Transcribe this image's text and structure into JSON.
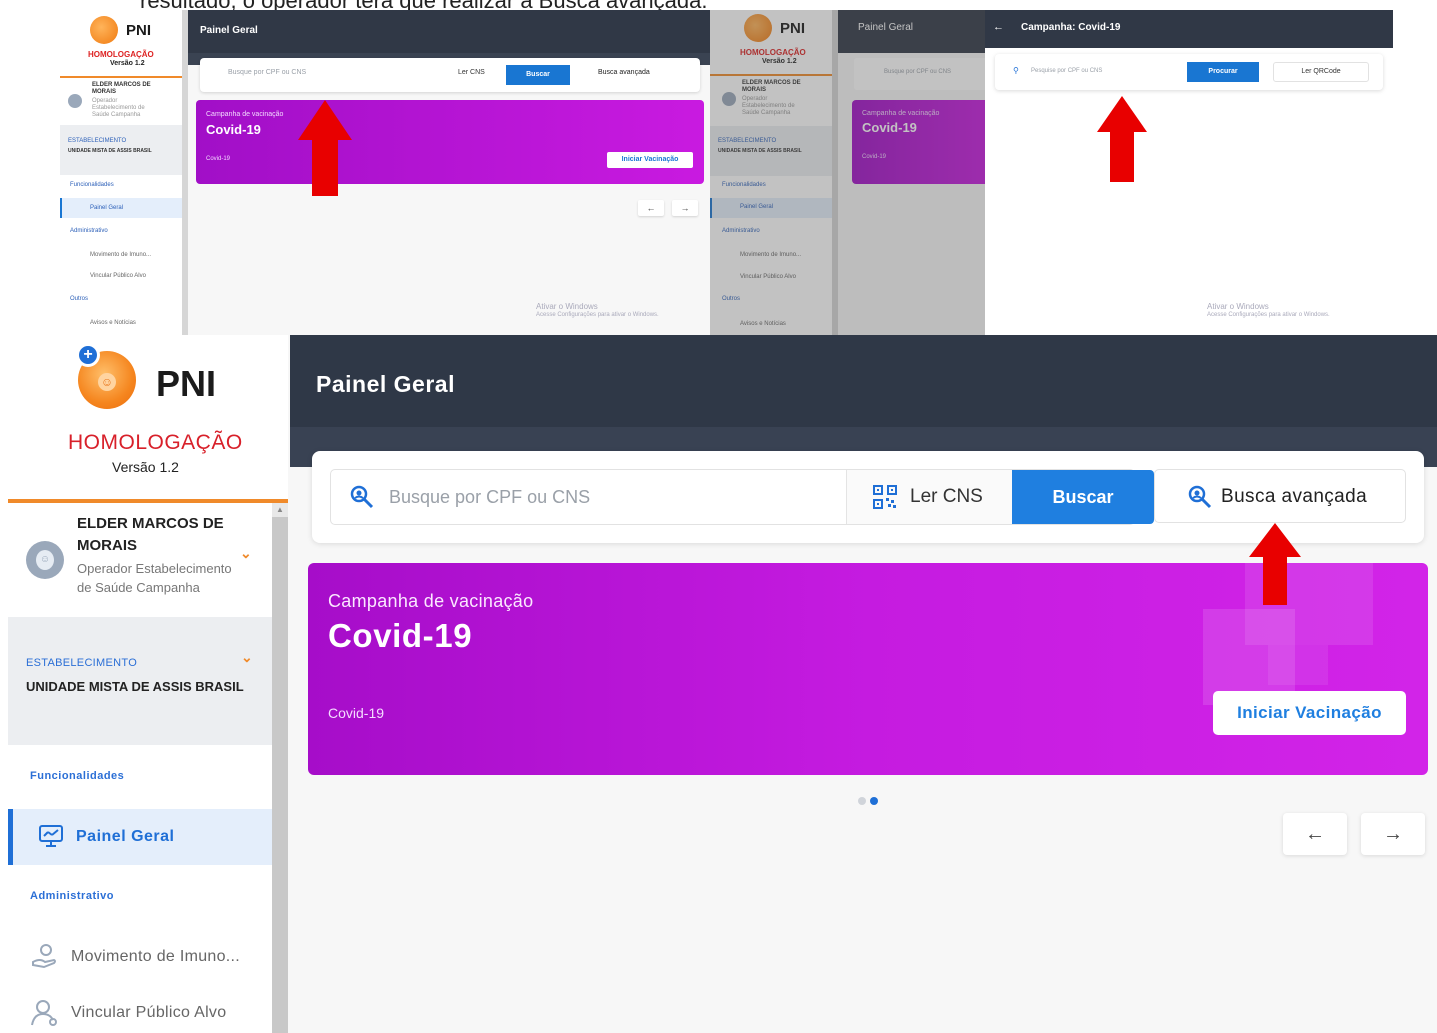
{
  "caption": "resultado, o operador terá que realizar a Busca avançada.",
  "app": {
    "logo_text": "PNI",
    "environment": "HOMOLOGAÇÃO",
    "version": "Versão 1.2"
  },
  "user": {
    "name": "ELDER MARCOS DE MORAIS",
    "role": "Operador Estabelecimento de Saúde Campanha"
  },
  "establishment": {
    "label": "ESTABELECIMENTO",
    "name": "UNIDADE MISTA DE ASSIS BRASIL"
  },
  "sidebar": {
    "section_features": "Funcionalidades",
    "section_admin": "Administrativo",
    "section_other": "Outros",
    "items": [
      {
        "label": "Painel Geral",
        "active": true,
        "icon": "dashboard-icon"
      },
      {
        "label": "Movimento de Imuno...",
        "icon": "vaccine-movement-icon"
      },
      {
        "label": "Vincular Público Alvo",
        "icon": "user-link-icon"
      },
      {
        "label": "Avisos e Notícias",
        "icon": "news-icon"
      }
    ]
  },
  "header": {
    "title": "Painel Geral"
  },
  "search": {
    "placeholder": "Busque por CPF ou CNS",
    "read_cns": "Ler CNS",
    "search_button": "Buscar",
    "advanced_search": "Busca avançada"
  },
  "campaign": {
    "label": "Campanha de vacinação",
    "name": "Covid-19",
    "tag": "Covid-19",
    "start_button": "Iniciar Vacinação"
  },
  "carousel": {
    "prev": "←",
    "next": "→",
    "active_index": 1,
    "count": 2
  },
  "campaign_panel": {
    "back": "←",
    "title": "Campanha: Covid-19",
    "placeholder": "Pesquise por CPF ou CNS",
    "search_button": "Procurar",
    "read_qr": "Ler QRCode"
  },
  "watermark": {
    "line1": "Ativar o Windows",
    "line2": "Acesse Configurações para ativar o Windows."
  },
  "colors": {
    "accent": "#1f7fe0",
    "header": "#2f3847",
    "campaign_start": "#a60dc9",
    "campaign_end": "#d224e8",
    "brand_orange": "#f08a2a",
    "annotation_red": "#e80000"
  }
}
